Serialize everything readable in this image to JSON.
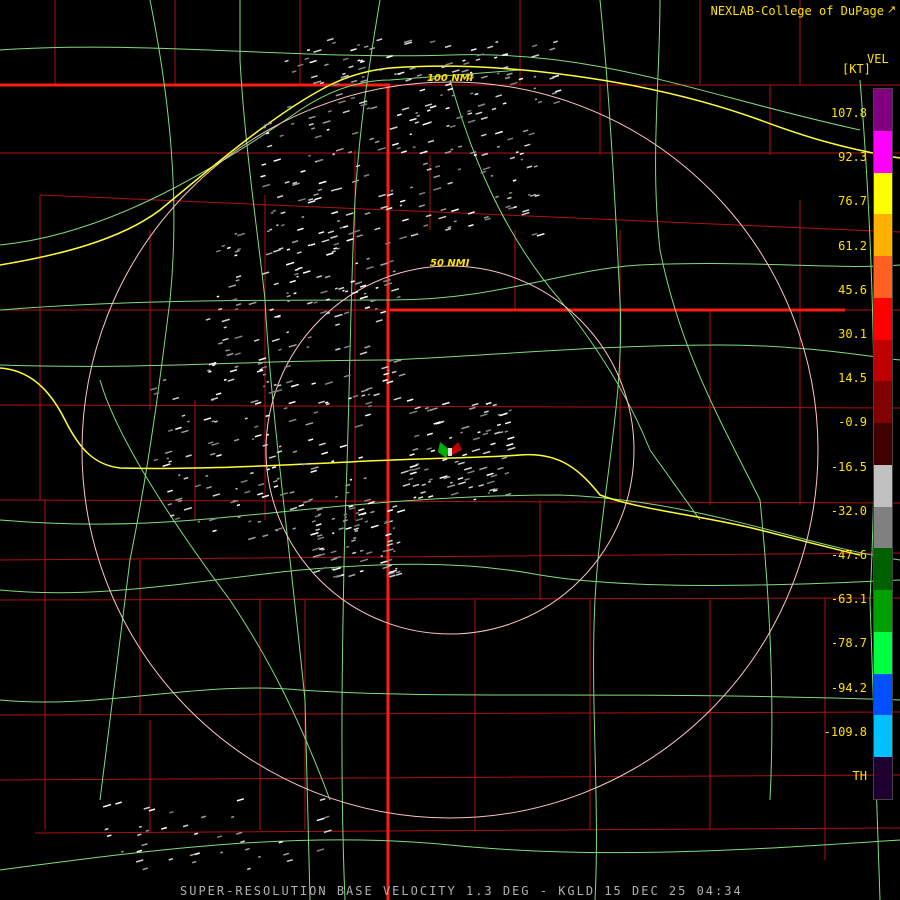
{
  "credit": "NEXLAB-College of DuPage",
  "credit_icon": "external-link-icon",
  "legend": {
    "field": "VEL",
    "unit": "[KT]",
    "ticks": [
      "107.8",
      "92.3",
      "76.7",
      "61.2",
      "45.6",
      "30.1",
      "14.5",
      "-0.9",
      "-16.5",
      "-32.0",
      "-47.6",
      "-63.1",
      "-78.7",
      "-94.2",
      "-109.8",
      "TH"
    ],
    "colors": [
      "#800080",
      "#ff00ff",
      "#ffff00",
      "#ffb000",
      "#ff6020",
      "#ff0000",
      "#c00000",
      "#800000",
      "#400000",
      "#c0c0c0",
      "#808080",
      "#006000",
      "#00a000",
      "#00ff40",
      "#0050ff",
      "#00c0ff",
      "#200030"
    ]
  },
  "range_rings": [
    {
      "label": "50 NMI"
    },
    {
      "label": "100 NMI"
    }
  ],
  "footer": "SUPER-RESOLUTION BASE VELOCITY 1.3 DEG - KGLD 15 DEC 25 04:34",
  "colors": {
    "county_lines": "#c01010",
    "state_lines": "#ff2020",
    "highways": "#80e080",
    "interstate": "#ffff40",
    "range_ring": "#ffc0c0",
    "text": "#ffe000"
  }
}
